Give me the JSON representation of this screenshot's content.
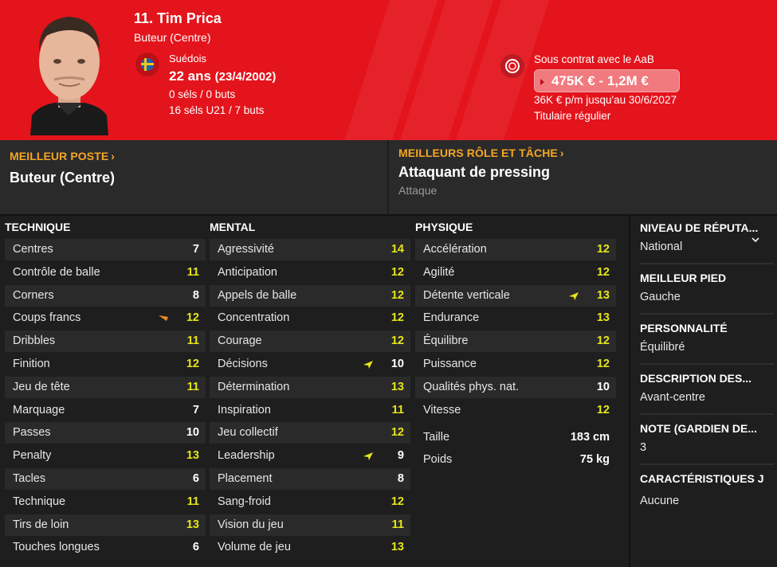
{
  "header": {
    "name": "11. Tim Prica",
    "position": "Buteur (Centre)",
    "nationality": "Suédois",
    "age": "22 ans",
    "dob": "(23/4/2002)",
    "senior_caps": "0 séls / 0 buts",
    "u21_caps": "16 séls U21 / 7 buts",
    "contract_with": "Sous contrat avec le AaB",
    "value_range": "475K € - 1,2M €",
    "wage": "36K € p/m jusqu'au 30/6/2027",
    "status": "Titulaire régulier",
    "colors": {
      "header_red": "#e4141c",
      "flag_blue": "#1f5fb0",
      "flag_yellow": "#f2c71b"
    }
  },
  "best_position": {
    "heading": "MEILLEUR POSTE",
    "value": "Buteur (Centre)"
  },
  "best_role": {
    "heading": "MEILLEURS RÔLE ET TÂCHE",
    "value": "Attaquant de pressing",
    "duty": "Attaque"
  },
  "technique": {
    "title": "TECHNIQUE",
    "rows": [
      {
        "name": "Centres",
        "value": "7"
      },
      {
        "name": "Contrôle de balle",
        "value": "11"
      },
      {
        "name": "Corners",
        "value": "8"
      },
      {
        "name": "Coups francs",
        "value": "12",
        "trend": "orange"
      },
      {
        "name": "Dribbles",
        "value": "11"
      },
      {
        "name": "Finition",
        "value": "12"
      },
      {
        "name": "Jeu de tête",
        "value": "11"
      },
      {
        "name": "Marquage",
        "value": "7"
      },
      {
        "name": "Passes",
        "value": "10"
      },
      {
        "name": "Penalty",
        "value": "13"
      },
      {
        "name": "Tacles",
        "value": "6"
      },
      {
        "name": "Technique",
        "value": "11"
      },
      {
        "name": "Tirs de loin",
        "value": "13"
      },
      {
        "name": "Touches longues",
        "value": "6"
      }
    ]
  },
  "mental": {
    "title": "MENTAL",
    "rows": [
      {
        "name": "Agressivité",
        "value": "14"
      },
      {
        "name": "Anticipation",
        "value": "12"
      },
      {
        "name": "Appels de balle",
        "value": "12"
      },
      {
        "name": "Concentration",
        "value": "12"
      },
      {
        "name": "Courage",
        "value": "12"
      },
      {
        "name": "Décisions",
        "value": "10",
        "trend": "yellow"
      },
      {
        "name": "Détermination",
        "value": "13"
      },
      {
        "name": "Inspiration",
        "value": "11"
      },
      {
        "name": "Jeu collectif",
        "value": "12"
      },
      {
        "name": "Leadership",
        "value": "9",
        "trend": "yellow"
      },
      {
        "name": "Placement",
        "value": "8"
      },
      {
        "name": "Sang-froid",
        "value": "12"
      },
      {
        "name": "Vision du jeu",
        "value": "11"
      },
      {
        "name": "Volume de jeu",
        "value": "13"
      }
    ]
  },
  "physique": {
    "title": "PHYSIQUE",
    "rows": [
      {
        "name": "Accélération",
        "value": "12"
      },
      {
        "name": "Agilité",
        "value": "12"
      },
      {
        "name": "Détente verticale",
        "value": "13",
        "trend": "yellow"
      },
      {
        "name": "Endurance",
        "value": "13"
      },
      {
        "name": "Équilibre",
        "value": "12"
      },
      {
        "name": "Puissance",
        "value": "12"
      },
      {
        "name": "Qualités phys. nat.",
        "value": "10"
      },
      {
        "name": "Vitesse",
        "value": "12"
      }
    ],
    "height_label": "Taille",
    "height": "183 cm",
    "weight_label": "Poids",
    "weight": "75 kg"
  },
  "info": {
    "reputation_head": "NIVEAU DE RÉPUTA...",
    "reputation": "National",
    "foot_head": "MEILLEUR PIED",
    "foot": "Gauche",
    "personality_head": "PERSONNALITÉ",
    "personality": "Équilibré",
    "description_head": "DESCRIPTION DES...",
    "description": "Avant-centre",
    "note_head": "NOTE (GARDIEN DE...",
    "note": "3",
    "traits_head": "CARACTÉRISTIQUES J",
    "traits": "Aucune"
  },
  "value_colors": {
    "white": "#ffffff",
    "yellow": "#e6e619",
    "orange_trend": "#f08a24",
    "yellow_trend": "#e6e619",
    "accent": "#f5a623"
  }
}
